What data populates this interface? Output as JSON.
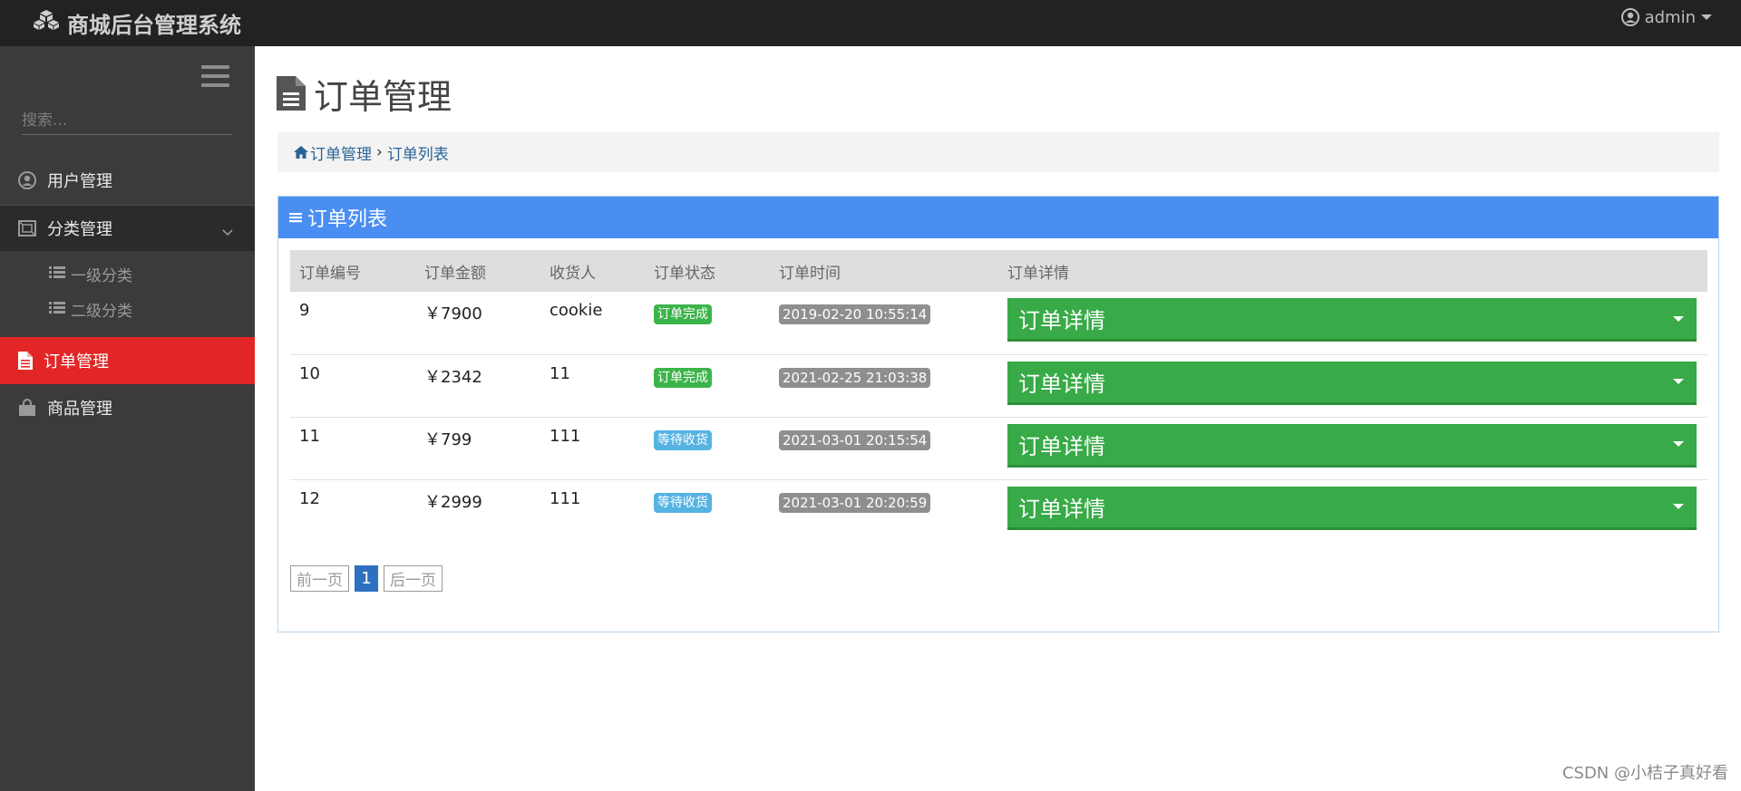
{
  "header": {
    "brand": "商城后台管理系统",
    "user": "admin"
  },
  "sidebar": {
    "search_placeholder": "搜索...",
    "items": [
      {
        "label": "用户管理",
        "icon": "user-circle-icon"
      },
      {
        "label": "分类管理",
        "icon": "category-icon"
      },
      {
        "label": "一级分类",
        "icon": "list-icon"
      },
      {
        "label": "二级分类",
        "icon": "list-icon"
      },
      {
        "label": "订单管理",
        "icon": "file-icon",
        "active": true
      },
      {
        "label": "商品管理",
        "icon": "bag-icon"
      }
    ]
  },
  "page": {
    "title": "订单管理",
    "breadcrumb": {
      "root": "订单管理",
      "sep": "›",
      "current": "订单列表"
    }
  },
  "panel": {
    "title": "订单列表",
    "columns": [
      "订单编号",
      "订单金额",
      "收货人",
      "订单状态",
      "订单时间",
      "订单详情"
    ],
    "rows": [
      {
        "id": "9",
        "amount": "￥7900",
        "receiver": "cookie",
        "status": "订单完成",
        "status_color": "#3bb54a",
        "time": "2019-02-20 10:55:14",
        "detail": "订单详情"
      },
      {
        "id": "10",
        "amount": "￥2342",
        "receiver": "11",
        "status": "订单完成",
        "status_color": "#3bb54a",
        "time": "2021-02-25 21:03:38",
        "detail": "订单详情"
      },
      {
        "id": "11",
        "amount": "￥799",
        "receiver": "111",
        "status": "等待收货",
        "status_color": "#55b3e2",
        "time": "2021-03-01 20:15:54",
        "detail": "订单详情"
      },
      {
        "id": "12",
        "amount": "￥2999",
        "receiver": "111",
        "status": "等待收货",
        "status_color": "#55b3e2",
        "time": "2021-03-01 20:20:59",
        "detail": "订单详情"
      }
    ],
    "pager": {
      "prev": "前一页",
      "current": "1",
      "next": "后一页"
    }
  },
  "watermark": "CSDN @小桔子真好看",
  "colors": {
    "topbar": "#222222",
    "sidebar": "#3b3b3b",
    "active": "#e22626",
    "panel_head": "#4a8ef2",
    "detail_btn": "#38aa47"
  }
}
